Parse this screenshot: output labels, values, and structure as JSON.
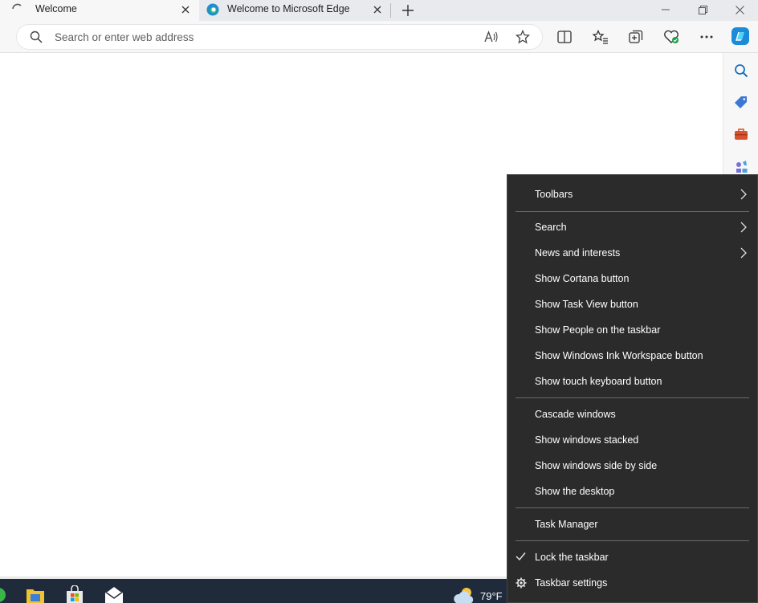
{
  "browser": {
    "tabs": [
      {
        "title": "Welcome",
        "loading": true
      },
      {
        "title": "Welcome to Microsoft Edge"
      }
    ],
    "address_placeholder": "Search or enter web address",
    "accent": "#0078d4"
  },
  "context_menu": {
    "items": [
      {
        "label": "Toolbars",
        "submenu": true
      },
      {
        "label": "Search",
        "submenu": true
      },
      {
        "label": "News and interests",
        "submenu": true
      },
      {
        "label": "Show Cortana button"
      },
      {
        "label": "Show Task View button"
      },
      {
        "label": "Show People on the taskbar"
      },
      {
        "label": "Show Windows Ink Workspace button"
      },
      {
        "label": "Show touch keyboard button"
      },
      {
        "label": "Cascade windows"
      },
      {
        "label": "Show windows stacked"
      },
      {
        "label": "Show windows side by side"
      },
      {
        "label": "Show the desktop"
      },
      {
        "label": "Task Manager"
      },
      {
        "label": "Lock the taskbar",
        "checked": true
      },
      {
        "label": "Taskbar settings",
        "icon": "gear-icon"
      }
    ]
  },
  "taskbar": {
    "weather_temp": "79°F",
    "apps": [
      "file-explorer-icon",
      "store-icon",
      "mail-icon"
    ]
  }
}
